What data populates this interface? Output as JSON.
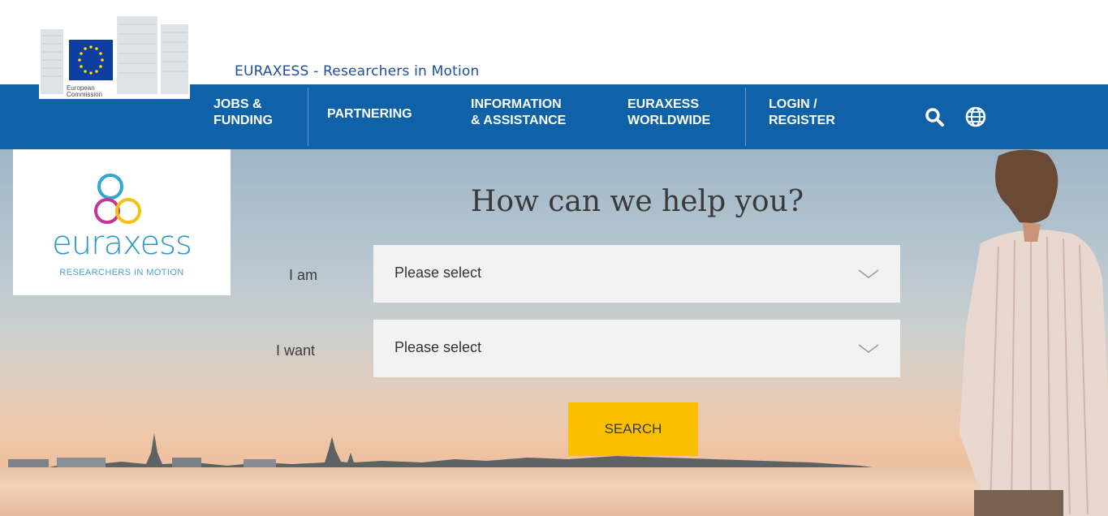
{
  "header": {
    "org_name": "European Commission",
    "site_tagline": "EURAXESS - Researchers in Motion"
  },
  "nav": {
    "items": [
      {
        "label": "JOBS &\nFUNDING"
      },
      {
        "label": "PARTNERING"
      },
      {
        "label": "INFORMATION\n& ASSISTANCE"
      },
      {
        "label": "EURAXESS\nWORLDWIDE"
      },
      {
        "label": "LOGIN /\nREGISTER"
      }
    ],
    "icons": [
      "search-icon",
      "globe-icon"
    ]
  },
  "hero": {
    "logo_word": "euraxess",
    "logo_tagline": "RESEARCHERS IN MOTION",
    "title": "How can we help you?",
    "form": {
      "i_am_label": "I am",
      "i_am_value": "Please select",
      "i_want_label": "I want",
      "i_want_value": "Please select",
      "search_label": "SEARCH"
    }
  },
  "colors": {
    "nav_bg": "#0f62a8",
    "search_button": "#fcbf00",
    "logo_text": "#2f97c8"
  }
}
